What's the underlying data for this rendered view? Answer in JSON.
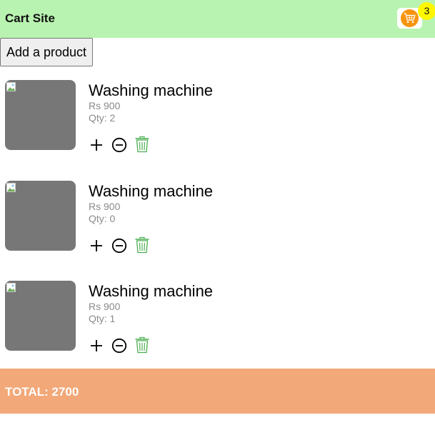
{
  "navbar": {
    "brand": "Cart Site",
    "cart_icon": "cart-icon",
    "cart_count": "3",
    "background": "#b9f3b1",
    "cart_color": "#f7940f",
    "badge_color": "#fff700"
  },
  "toolbar": {
    "add_label": "Add a product"
  },
  "items": [
    {
      "title": "Washing machine",
      "price": "Rs 900",
      "qty": "Qty: 2"
    },
    {
      "title": "Washing machine",
      "price": "Rs 900",
      "qty": "Qty: 0"
    },
    {
      "title": "Washing machine",
      "price": "Rs 900",
      "qty": "Qty: 1"
    }
  ],
  "icons": {
    "increase": "plus-icon",
    "decrease": "minus-circle-icon",
    "delete": "trash-icon",
    "delete_color": "#4caf50"
  },
  "footer": {
    "total": "TOTAL: 2700",
    "background": "#f2a878"
  }
}
